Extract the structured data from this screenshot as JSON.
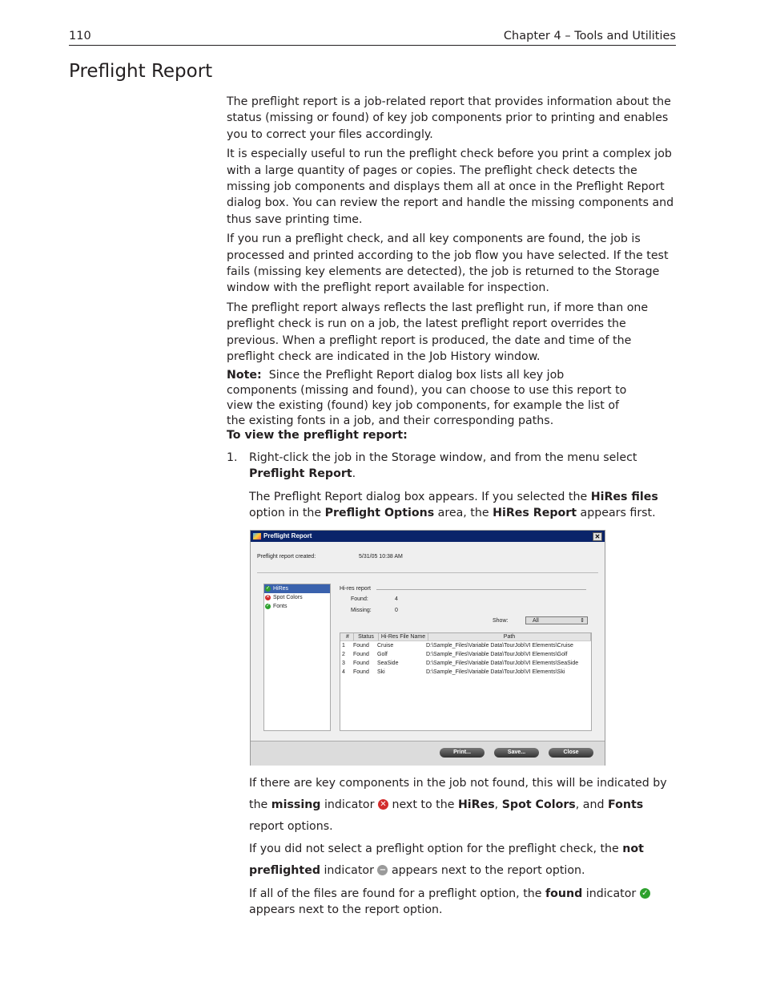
{
  "header": {
    "page_number": "110",
    "chapter": "Chapter 4 – Tools and Utilities"
  },
  "title": "Preflight Report",
  "paragraphs": [
    "The preflight report is a job-related report that provides information about the status (missing or found) of key job components prior to printing and enables you to correct your files accordingly.",
    "It is especially useful to run the preflight check before you print a complex job with a large quantity of pages or copies. The preflight check detects the missing job components and displays them all at once in the Preflight Report dialog box. You can review the report and handle the missing components and thus save printing time.",
    "If you run a preflight check, and all key components are found, the job is processed and printed according to the job flow you have selected. If the test fails (missing key elements are detected), the job is returned to the Storage window with the preflight report available for inspection.",
    "The preflight report always reflects the last preflight run, if more than one preflight check is run on a job, the latest preflight report overrides the previous. When a preflight report is produced, the date and time of the preflight check are indicated in the Job History window."
  ],
  "note": {
    "label": "Note:",
    "text": "Since the Preflight Report dialog box lists all key job components (missing and found), you can choose to use this report to view the existing (found) key job components, for example the list of the existing fonts in a job, and their corresponding paths."
  },
  "procedure_heading": "To view the preflight report:",
  "step1": {
    "number": "1.",
    "parts": [
      [
        "Right-click the job in the Storage window, and from the menu select ",
        false
      ],
      [
        "Preflight Report",
        true
      ],
      [
        ".",
        false
      ]
    ]
  },
  "step1_result": [
    [
      "The Preflight Report dialog box appears. If you selected the ",
      false
    ],
    [
      "HiRes files",
      true
    ],
    [
      " option in the ",
      false
    ],
    [
      "Preflight Options",
      true
    ],
    [
      " area, the ",
      false
    ],
    [
      "HiRes Report",
      true
    ],
    [
      " appears first.",
      false
    ]
  ],
  "after": [
    [
      [
        "If there are key components in the job not found, this will be indicated by the ",
        false
      ],
      [
        "missing",
        true
      ],
      [
        " indicator ",
        false
      ],
      [
        "ICON:missing",
        false
      ],
      [
        " next to the ",
        false
      ],
      [
        "HiRes",
        true
      ],
      [
        ", ",
        false
      ],
      [
        "Spot Colors",
        true
      ],
      [
        ", and ",
        false
      ],
      [
        "Fonts",
        true
      ],
      [
        " report options.",
        false
      ]
    ],
    [
      [
        "If you did not select a preflight option for the preflight check, the ",
        false
      ],
      [
        "not preflighted",
        true
      ],
      [
        " indicator ",
        false
      ],
      [
        "ICON:not-preflighted",
        false
      ],
      [
        " appears next to the report option.",
        false
      ]
    ],
    [
      [
        "If all of the files are found for a preflight option, the ",
        false
      ],
      [
        "found",
        true
      ],
      [
        " indicator ",
        false
      ],
      [
        "ICON:found",
        false
      ],
      [
        " appears next to the report option.",
        false
      ]
    ]
  ],
  "colors": {
    "found": "#2ea12e",
    "missing": "#d22b2b",
    "not_preflighted": "#9a9a9a",
    "titlebar": "#0a246a",
    "selection": "#3a62ad"
  },
  "dialog": {
    "title": "Preflight Report",
    "created_label": "Preflight report created:",
    "created_value": "5/31/05 10:38 AM",
    "options": [
      {
        "label": "HiRes",
        "status": "found"
      },
      {
        "label": "Spot Colors",
        "status": "missing"
      },
      {
        "label": "Fonts",
        "status": "found"
      }
    ],
    "report_title": "Hi-res report",
    "found_label": "Found:",
    "found_value": "4",
    "missing_label": "Missing:",
    "missing_value": "0",
    "show_label": "Show:",
    "show_value": "All",
    "columns": [
      "#",
      "Status",
      "Hi-Res File Name",
      "Path"
    ],
    "rows": [
      [
        "1",
        "Found",
        "Cruise",
        "D:\\Sample_Files\\Variable Data\\TourJob\\VI Elements\\Cruise"
      ],
      [
        "2",
        "Found",
        "Golf",
        "D:\\Sample_Files\\Variable Data\\TourJob\\VI Elements\\Golf"
      ],
      [
        "3",
        "Found",
        "SeaSide",
        "D:\\Sample_Files\\Variable Data\\TourJob\\VI Elements\\SeaSide"
      ],
      [
        "4",
        "Found",
        "Ski",
        "D:\\Sample_Files\\Variable Data\\TourJob\\VI Elements\\Ski"
      ]
    ],
    "buttons": {
      "print": "Print...",
      "save": "Save...",
      "close": "Close"
    }
  }
}
